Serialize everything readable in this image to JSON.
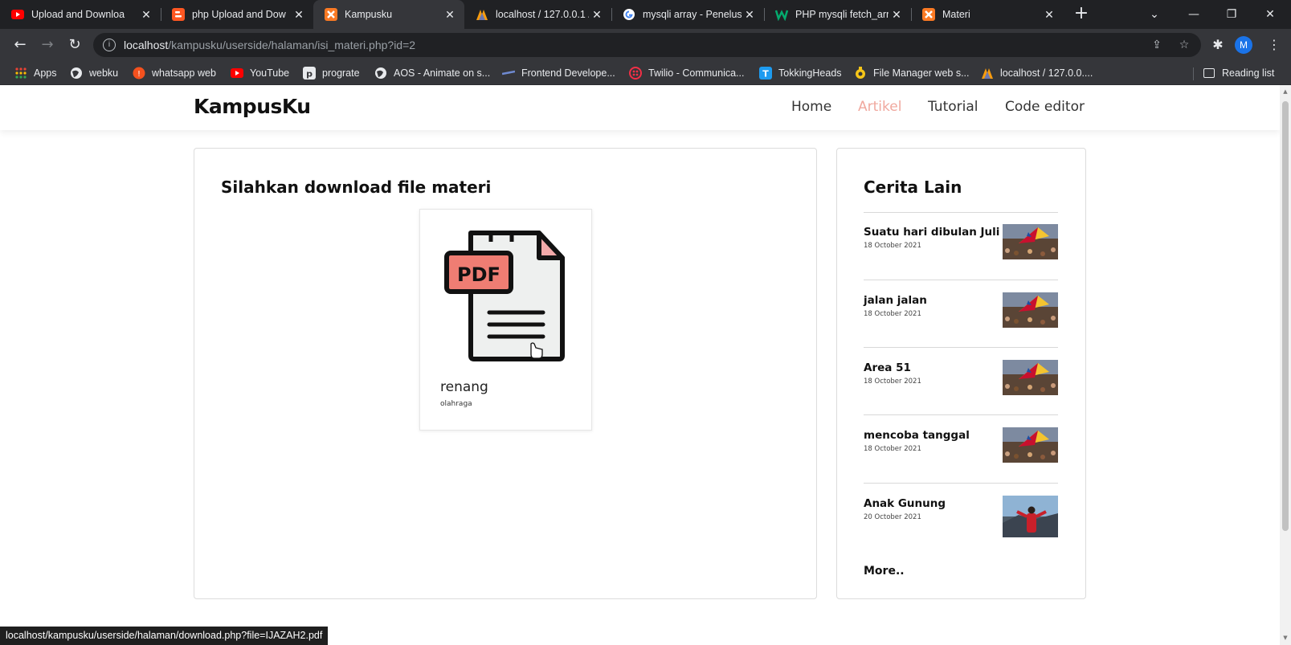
{
  "browser": {
    "tabs": [
      {
        "title": "Upload and Downloa",
        "icon": "youtube-icon",
        "color": "#ff0000"
      },
      {
        "title": "php Upload and Dow",
        "icon": "blogger-icon",
        "color": "#ff5722"
      },
      {
        "title": "Kampusku",
        "icon": "xampp-icon",
        "color": "#fb7a24",
        "active": true
      },
      {
        "title": "localhost / 127.0.0.1 /",
        "icon": "phpmyadmin-icon",
        "color": "#f89c0e"
      },
      {
        "title": "mysqli array - Penelus",
        "icon": "google-icon",
        "color": "#4285f4"
      },
      {
        "title": "PHP mysqli fetch_arra",
        "icon": "w3schools-icon",
        "color": "#04aa6d"
      },
      {
        "title": "Materi",
        "icon": "xampp-icon",
        "color": "#fb7a24"
      }
    ],
    "new_tab": "+",
    "address": {
      "host": "localhost",
      "path": "/kampusku/userside/halaman/isi_materi.php?id=2"
    },
    "profile_initial": "M",
    "bookmarks": [
      {
        "label": "Apps",
        "icon": "apps-grid-icon",
        "color": "#ea4335"
      },
      {
        "label": "webku",
        "icon": "globe-icon",
        "color": "#e8eaed"
      },
      {
        "label": "whatsapp web",
        "icon": "whatsapp-icon",
        "color": "#f4511e"
      },
      {
        "label": "YouTube",
        "icon": "youtube-icon",
        "color": "#ff0000"
      },
      {
        "label": "prograte",
        "icon": "prograte-icon",
        "color": "#e8eaed"
      },
      {
        "label": "AOS - Animate on s...",
        "icon": "globe-icon",
        "color": "#e8eaed"
      },
      {
        "label": "Frontend Develope...",
        "icon": "frontend-icon",
        "color": "#6f8ad1"
      },
      {
        "label": "Twilio - Communica...",
        "icon": "twilio-icon",
        "color": "#f22f46"
      },
      {
        "label": "TokkingHeads",
        "icon": "tokkingheads-icon",
        "color": "#1d9bf0"
      },
      {
        "label": "File Manager web s...",
        "icon": "file-manager-icon",
        "color": "#f5c518"
      },
      {
        "label": "localhost / 127.0.0....",
        "icon": "phpmyadmin-icon",
        "color": "#f89c0e"
      }
    ],
    "reading_list": "Reading list",
    "status_url": "localhost/kampusku/userside/halaman/download.php?file=IJAZAH2.pdf"
  },
  "site": {
    "brand": "KampusKu",
    "nav": [
      "Home",
      "Artikel",
      "Tutorial",
      "Code editor"
    ],
    "active_nav": "Artikel",
    "accent": "#f0a89e"
  },
  "main": {
    "title": "Silahkan download file materi",
    "file": {
      "badge": "PDF",
      "name": "renang",
      "category": "olahraga"
    }
  },
  "sidebar": {
    "title": "Cerita Lain",
    "stories": [
      {
        "title": "Suatu hari dibulan Juli",
        "date": "18 October 2021",
        "thumb": "crowd-flag"
      },
      {
        "title": "jalan jalan",
        "date": "18 October 2021",
        "thumb": "crowd-flag"
      },
      {
        "title": "Area 51",
        "date": "18 October 2021",
        "thumb": "crowd-flag"
      },
      {
        "title": "mencoba tanggal",
        "date": "18 October 2021",
        "thumb": "crowd-flag"
      },
      {
        "title": "Anak Gunung",
        "date": "20 October 2021",
        "thumb": "mountain-person"
      }
    ],
    "more": "More.."
  }
}
